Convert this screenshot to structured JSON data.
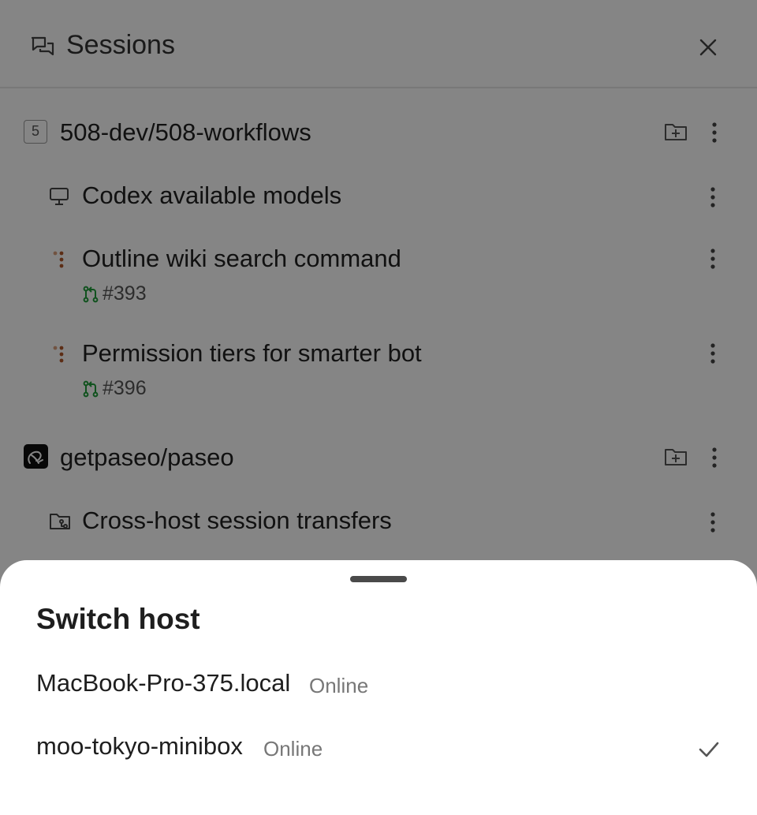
{
  "header": {
    "title": "Sessions",
    "icon": "chat-bubbles-icon",
    "close_icon": "close-icon"
  },
  "projects": [
    {
      "name": "508-dev/508-workflows",
      "badge": "5",
      "sessions": [
        {
          "title": "Codex available models",
          "icon": "monitor-icon"
        },
        {
          "title": "Outline wiki search command",
          "icon": "agent-dots-icon",
          "pr": "#393"
        },
        {
          "title": "Permission tiers for smarter bot",
          "icon": "agent-dots-icon",
          "pr": "#396"
        }
      ]
    },
    {
      "name": "getpaseo/paseo",
      "logo": "paseo-logo",
      "sessions": [
        {
          "title": "Cross-host session transfers",
          "icon": "folder-git-icon"
        }
      ]
    }
  ],
  "sheet": {
    "title": "Switch host",
    "hosts": [
      {
        "name": "MacBook-Pro-375.local",
        "status": "Online",
        "selected": false
      },
      {
        "name": "moo-tokyo-minibox",
        "status": "Online",
        "selected": true
      }
    ]
  },
  "colors": {
    "scrim": "rgba(0,0,0,0.48)",
    "pr_green": "#1f9d3a",
    "agent_orange": "#b0562a"
  }
}
